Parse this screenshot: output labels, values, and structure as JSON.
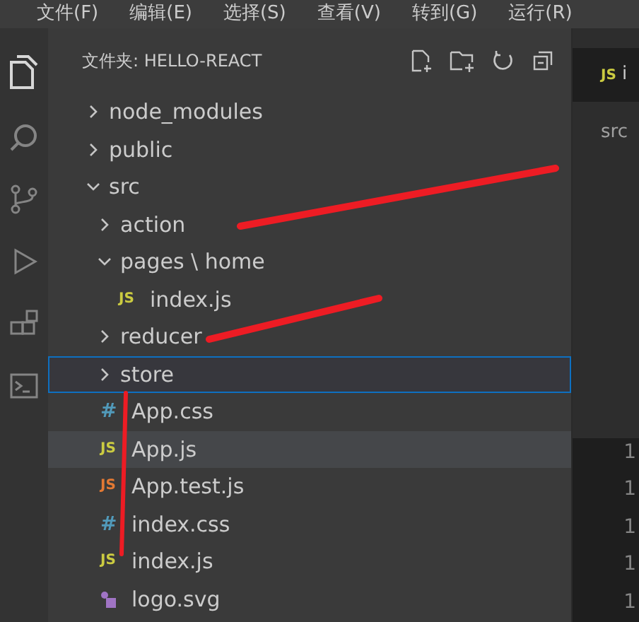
{
  "menu_bar": [
    "文件(F)",
    "编辑(E)",
    "选择(S)",
    "查看(V)",
    "转到(G)",
    "运行(R)"
  ],
  "explorer": {
    "title": "文件夹: HELLO-REACT",
    "tree": [
      {
        "kind": "folder",
        "name": "node_modules",
        "expanded": false,
        "selected": false,
        "hovered": false
      },
      {
        "kind": "folder",
        "name": "public",
        "expanded": false,
        "selected": false,
        "hovered": false
      },
      {
        "kind": "folder",
        "name": "src",
        "expanded": true,
        "selected": false,
        "hovered": false,
        "children": [
          {
            "kind": "folder",
            "name": "action",
            "expanded": false,
            "selected": false,
            "hovered": false
          },
          {
            "kind": "folder",
            "name": "pages \\ home",
            "expanded": true,
            "selected": false,
            "hovered": false,
            "children": [
              {
                "kind": "js",
                "icon": "JS",
                "name": "index.js",
                "selected": false,
                "hovered": false
              }
            ]
          },
          {
            "kind": "folder",
            "name": "reducer",
            "expanded": false,
            "selected": false,
            "hovered": false
          },
          {
            "kind": "folder",
            "name": "store",
            "expanded": false,
            "selected": true,
            "hovered": false
          },
          {
            "kind": "css",
            "icon": "#",
            "name": "App.css",
            "selected": false,
            "hovered": false
          },
          {
            "kind": "js",
            "icon": "JS",
            "name": "App.js",
            "selected": false,
            "hovered": true
          },
          {
            "kind": "test",
            "icon": "JS",
            "name": "App.test.js",
            "selected": false,
            "hovered": false
          },
          {
            "kind": "css",
            "icon": "#",
            "name": "index.css",
            "selected": false,
            "hovered": false
          },
          {
            "kind": "js",
            "icon": "JS",
            "name": "index.js",
            "selected": false,
            "hovered": false
          },
          {
            "kind": "svg",
            "name": "logo.svg",
            "selected": false,
            "hovered": false
          }
        ]
      }
    ]
  },
  "editor": {
    "tab": {
      "icon": "JS",
      "label": "i"
    },
    "breadcrumb": "src",
    "line_numbers": [
      "1",
      "1",
      "1",
      "1",
      "1"
    ]
  }
}
